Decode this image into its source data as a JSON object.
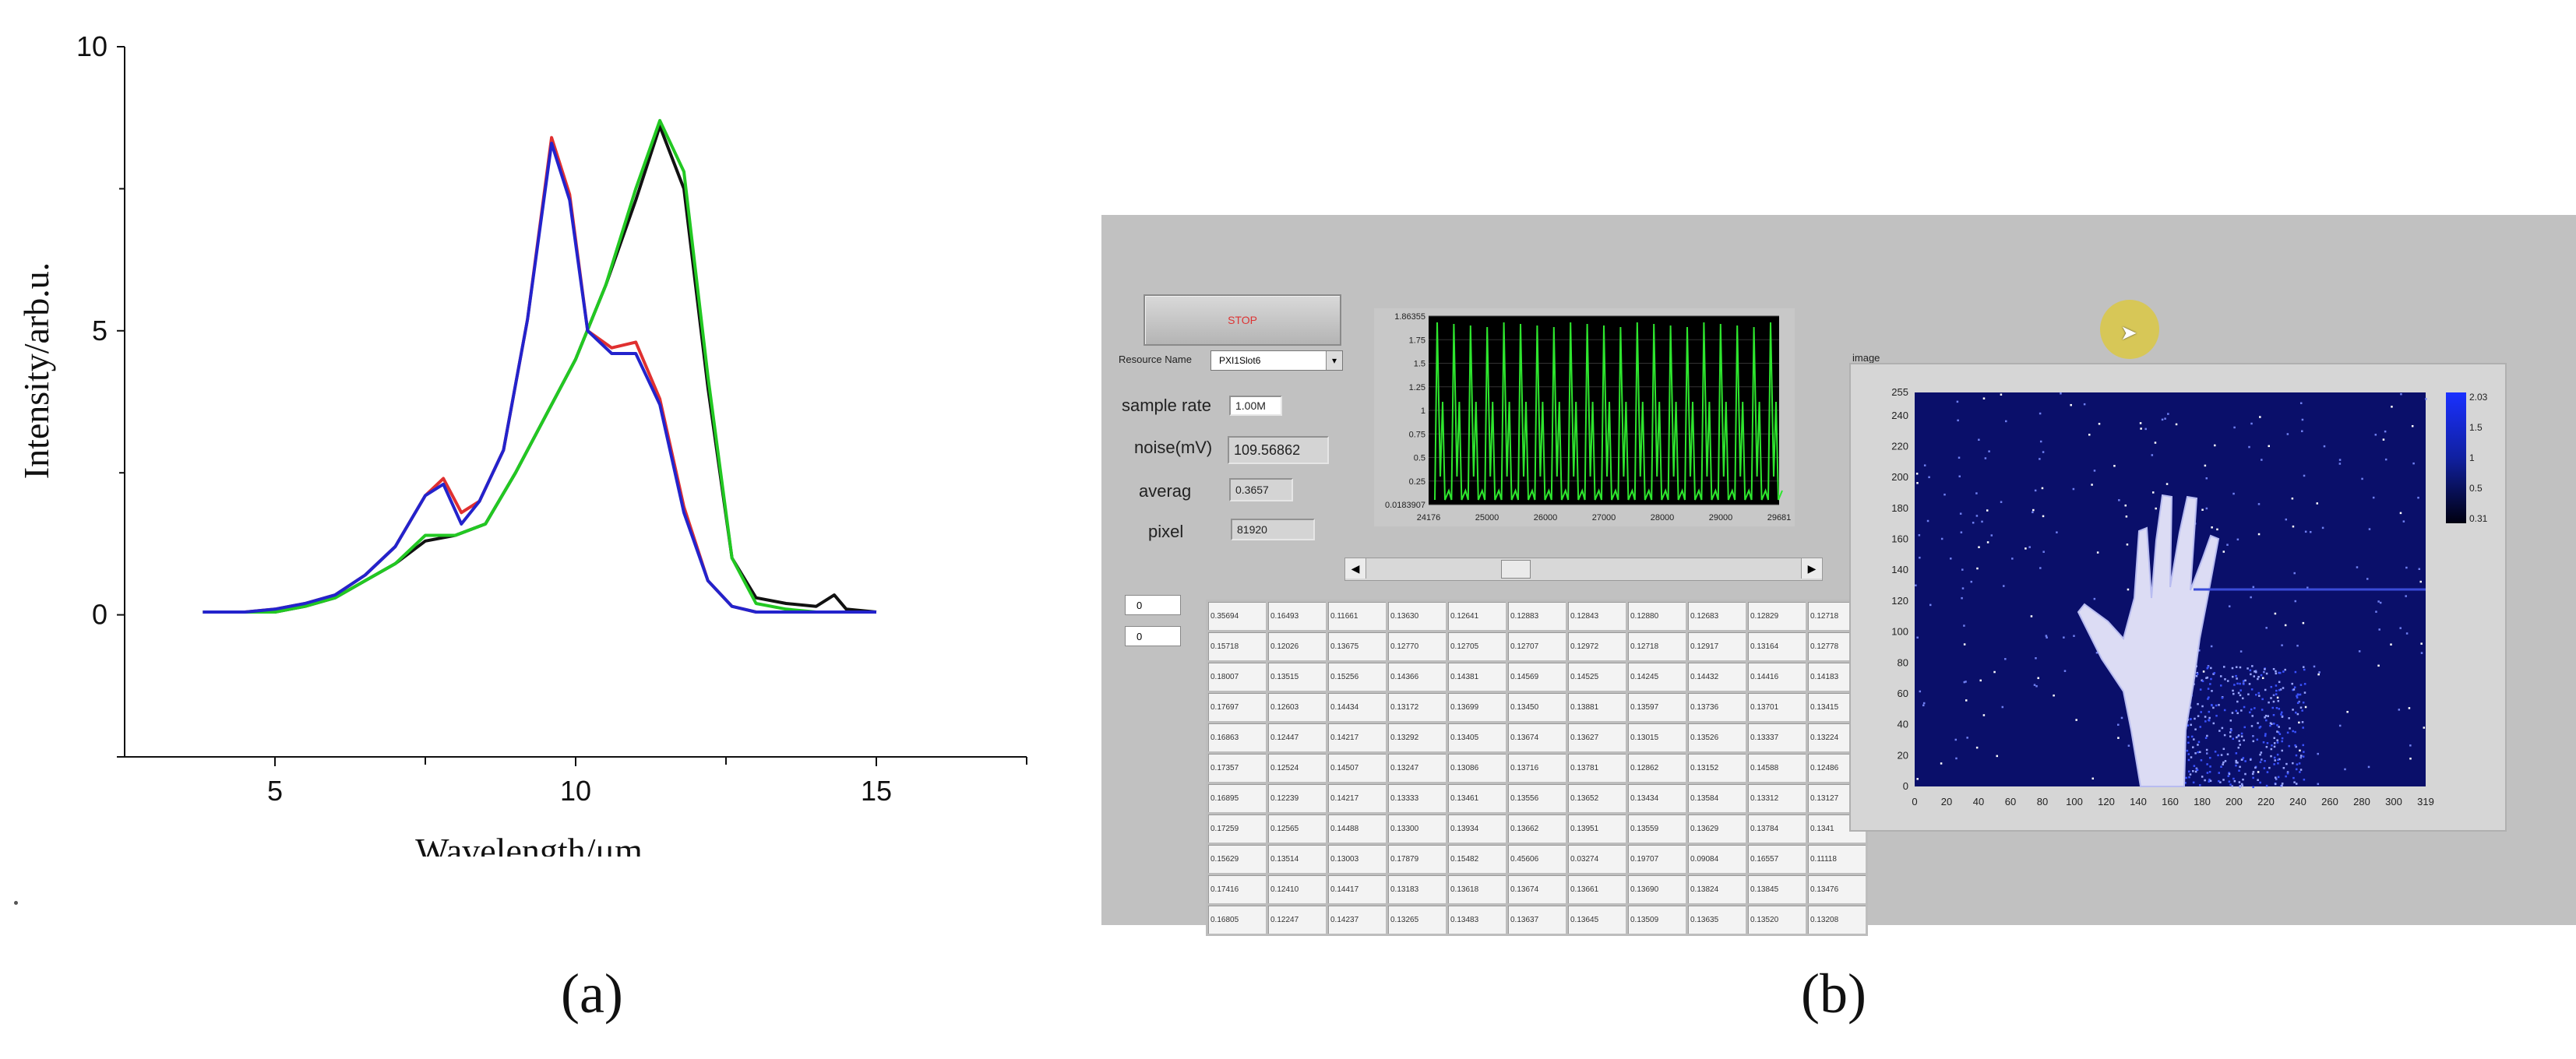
{
  "figure_a": {
    "caption": "(a)",
    "chart_data": {
      "type": "line",
      "xlabel": "Wavelength/μm",
      "ylabel": "Intensity/arb.u.",
      "xlim": [
        2.5,
        17.5
      ],
      "ylim": [
        -2.5,
        10
      ],
      "xticks": [
        5,
        10,
        15
      ],
      "yticks": [
        0,
        5,
        10
      ],
      "grid": false,
      "series": [
        {
          "color": "#111111",
          "x": [
            3.8,
            4.5,
            5.0,
            5.5,
            6.0,
            6.5,
            7.0,
            7.5,
            8.0,
            8.5,
            9.0,
            9.5,
            10.0,
            10.5,
            11.0,
            11.4,
            11.8,
            12.2,
            12.6,
            13.0,
            13.5,
            14.0,
            14.3,
            14.5,
            15.0
          ],
          "y": [
            0.05,
            0.05,
            0.05,
            0.15,
            0.3,
            0.6,
            0.9,
            1.3,
            1.4,
            1.6,
            2.5,
            3.5,
            4.5,
            5.8,
            7.3,
            8.6,
            7.5,
            4.0,
            1.0,
            0.3,
            0.2,
            0.15,
            0.35,
            0.1,
            0.05
          ]
        },
        {
          "color": "#e03030",
          "x": [
            3.8,
            4.5,
            5.0,
            5.5,
            6.0,
            6.5,
            7.0,
            7.5,
            7.8,
            8.1,
            8.4,
            8.8,
            9.2,
            9.6,
            9.9,
            10.2,
            10.6,
            11.0,
            11.4,
            11.8,
            12.2,
            12.6,
            13.0,
            13.5,
            14.0,
            15.0
          ],
          "y": [
            0.05,
            0.05,
            0.1,
            0.2,
            0.35,
            0.7,
            1.2,
            2.1,
            2.4,
            1.8,
            2.0,
            2.9,
            5.2,
            8.4,
            7.4,
            5.0,
            4.7,
            4.8,
            3.8,
            1.9,
            0.6,
            0.15,
            0.05,
            0.05,
            0.05,
            0.05
          ]
        },
        {
          "color": "#22c822",
          "x": [
            3.8,
            4.5,
            5.0,
            5.5,
            6.0,
            6.5,
            7.0,
            7.5,
            8.0,
            8.5,
            9.0,
            9.5,
            10.0,
            10.5,
            11.0,
            11.4,
            11.8,
            12.2,
            12.6,
            13.0,
            13.5,
            14.0,
            14.5,
            15.0
          ],
          "y": [
            0.05,
            0.05,
            0.05,
            0.15,
            0.3,
            0.6,
            0.9,
            1.4,
            1.4,
            1.6,
            2.5,
            3.5,
            4.5,
            5.8,
            7.5,
            8.7,
            7.8,
            4.2,
            1.0,
            0.2,
            0.1,
            0.05,
            0.05,
            0.05
          ]
        },
        {
          "color": "#2323cc",
          "x": [
            3.8,
            4.5,
            5.0,
            5.5,
            6.0,
            6.5,
            7.0,
            7.5,
            7.8,
            8.1,
            8.4,
            8.8,
            9.2,
            9.6,
            9.9,
            10.2,
            10.6,
            11.0,
            11.4,
            11.8,
            12.2,
            12.6,
            13.0,
            13.5,
            14.0,
            15.0
          ],
          "y": [
            0.05,
            0.05,
            0.1,
            0.2,
            0.35,
            0.7,
            1.2,
            2.1,
            2.3,
            1.6,
            2.0,
            2.9,
            5.2,
            8.3,
            7.3,
            5.0,
            4.6,
            4.6,
            3.7,
            1.8,
            0.6,
            0.15,
            0.05,
            0.05,
            0.05,
            0.05
          ]
        }
      ]
    }
  },
  "figure_b": {
    "caption": "(b)",
    "stop_label": "STOP",
    "resource_label": "Resource Name",
    "resource_value": "PXI1Slot6",
    "sample_rate_label": "sample rate",
    "sample_rate_value": "1.00M",
    "noise_label": "noise(mV)",
    "noise_value": "109.56862",
    "averag_label": "averag",
    "averag_value": "0.3657",
    "pixel_label": "pixel",
    "pixel_value": "81920",
    "index_row": "0",
    "index_col": "0",
    "image_label": "image",
    "waveform": {
      "yticks": [
        "1.86355",
        "1.75",
        "1.5",
        "1.25",
        "1",
        "0.75",
        "0.5",
        "0.25",
        "0.0183907"
      ],
      "xticks": [
        "24176",
        "25000",
        "26000",
        "27000",
        "28000",
        "29000",
        "29681"
      ]
    },
    "intensity_graph": {
      "xticks": [
        "0",
        "20",
        "40",
        "60",
        "80",
        "100",
        "120",
        "140",
        "160",
        "180",
        "200",
        "220",
        "240",
        "260",
        "280",
        "300",
        "319"
      ],
      "yticks": [
        "255",
        "240",
        "220",
        "200",
        "180",
        "160",
        "140",
        "120",
        "100",
        "80",
        "60",
        "40",
        "20",
        "0"
      ],
      "colorbar_ticks": [
        "2.03",
        "1.5",
        "1",
        "0.5",
        "0.31"
      ]
    },
    "table": [
      [
        "0.35694",
        "0.16493",
        "0.11661",
        "0.13630",
        "0.12641",
        "0.12883",
        "0.12843",
        "0.12880",
        "0.12683",
        "0.12829",
        "0.12718"
      ],
      [
        "0.15718",
        "0.12026",
        "0.13675",
        "0.12770",
        "0.12705",
        "0.12707",
        "0.12972",
        "0.12718",
        "0.12917",
        "0.13164",
        "0.12778"
      ],
      [
        "0.18007",
        "0.13515",
        "0.15256",
        "0.14366",
        "0.14381",
        "0.14569",
        "0.14525",
        "0.14245",
        "0.14432",
        "0.14416",
        "0.14183"
      ],
      [
        "0.17697",
        "0.12603",
        "0.14434",
        "0.13172",
        "0.13699",
        "0.13450",
        "0.13881",
        "0.13597",
        "0.13736",
        "0.13701",
        "0.13415"
      ],
      [
        "0.16863",
        "0.12447",
        "0.14217",
        "0.13292",
        "0.13405",
        "0.13674",
        "0.13627",
        "0.13015",
        "0.13526",
        "0.13337",
        "0.13224"
      ],
      [
        "0.17357",
        "0.12524",
        "0.14507",
        "0.13247",
        "0.13086",
        "0.13716",
        "0.13781",
        "0.12862",
        "0.13152",
        "0.14588",
        "0.12486"
      ],
      [
        "0.16895",
        "0.12239",
        "0.14217",
        "0.13333",
        "0.13461",
        "0.13556",
        "0.13652",
        "0.13434",
        "0.13584",
        "0.13312",
        "0.13127"
      ],
      [
        "0.17259",
        "0.12565",
        "0.14488",
        "0.13300",
        "0.13934",
        "0.13662",
        "0.13951",
        "0.13559",
        "0.13629",
        "0.13784",
        "0.1341"
      ],
      [
        "0.15629",
        "0.13514",
        "0.13003",
        "0.17879",
        "0.15482",
        "0.45606",
        "0.03274",
        "0.19707",
        "0.09084",
        "0.16557",
        "0.11118"
      ],
      [
        "0.17416",
        "0.12410",
        "0.14417",
        "0.13183",
        "0.13618",
        "0.13674",
        "0.13661",
        "0.13690",
        "0.13824",
        "0.13845",
        "0.13476"
      ],
      [
        "0.16805",
        "0.12247",
        "0.14237",
        "0.13265",
        "0.13483",
        "0.13637",
        "0.13645",
        "0.13509",
        "0.13635",
        "0.13520",
        "0.13208"
      ]
    ]
  }
}
